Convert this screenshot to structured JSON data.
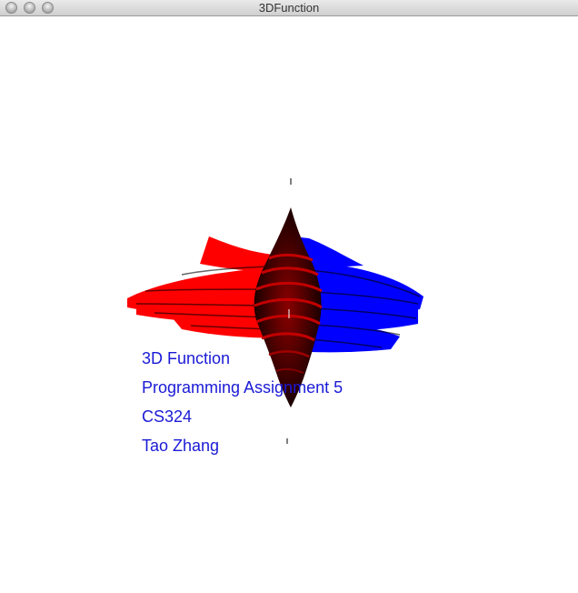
{
  "window": {
    "title": "3DFunction"
  },
  "colors": {
    "surface_left": "#ff0000",
    "surface_right": "#0000ff",
    "surface_center": "#000000",
    "overlay_text": "#1a1ad6"
  },
  "overlay": {
    "line1": "3D Function",
    "line2": "Programming Assignment 5",
    "line3": "CS324",
    "line4": "Tao Zhang"
  }
}
